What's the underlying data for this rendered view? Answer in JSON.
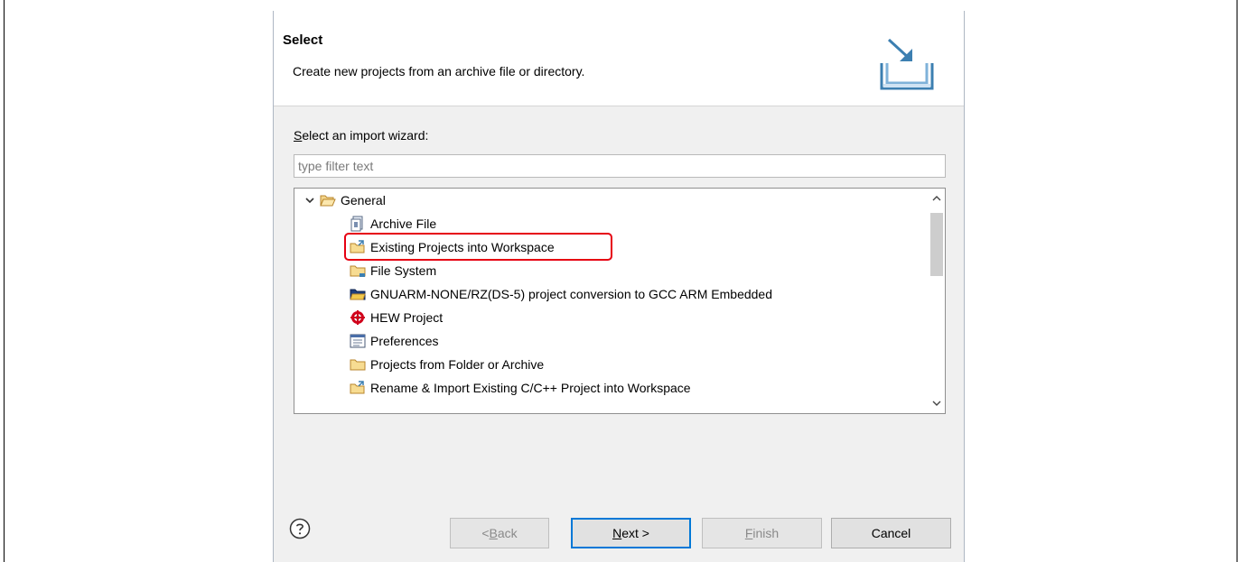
{
  "header": {
    "title": "Select",
    "description": "Create new projects from an archive file or directory."
  },
  "wizard": {
    "label_mnemonic": "S",
    "label_rest": "elect an import wizard:",
    "filter_placeholder": "type filter text"
  },
  "tree": {
    "group": {
      "label": "General",
      "icon": "open-folder-icon",
      "expanded": true
    },
    "items": [
      {
        "label": "Archive File",
        "icon": "archive-file-icon"
      },
      {
        "label": "Existing Projects into Workspace",
        "icon": "import-project-icon",
        "highlighted": true
      },
      {
        "label": "File System",
        "icon": "folder-icon"
      },
      {
        "label": "GNUARM-NONE/RZ(DS-5)  project conversion to GCC ARM Embedded",
        "icon": "gnuarm-folder-icon"
      },
      {
        "label": "HEW Project",
        "icon": "hew-icon"
      },
      {
        "label": "Preferences",
        "icon": "preferences-icon"
      },
      {
        "label": "Projects from Folder or Archive",
        "icon": "folder-icon"
      },
      {
        "label": "Rename & Import Existing C/C++ Project into Workspace",
        "icon": "import-project-icon"
      }
    ]
  },
  "buttons": {
    "back_prefix": "< ",
    "back_mnemonic": "B",
    "back_rest": "ack",
    "next_mnemonic": "N",
    "next_rest": "ext >",
    "finish_mnemonic": "F",
    "finish_rest": "inish",
    "cancel": "Cancel"
  },
  "colors": {
    "highlight_border": "#e60012",
    "default_button_border": "#0078d7",
    "header_icon": "#3c7fb1"
  }
}
